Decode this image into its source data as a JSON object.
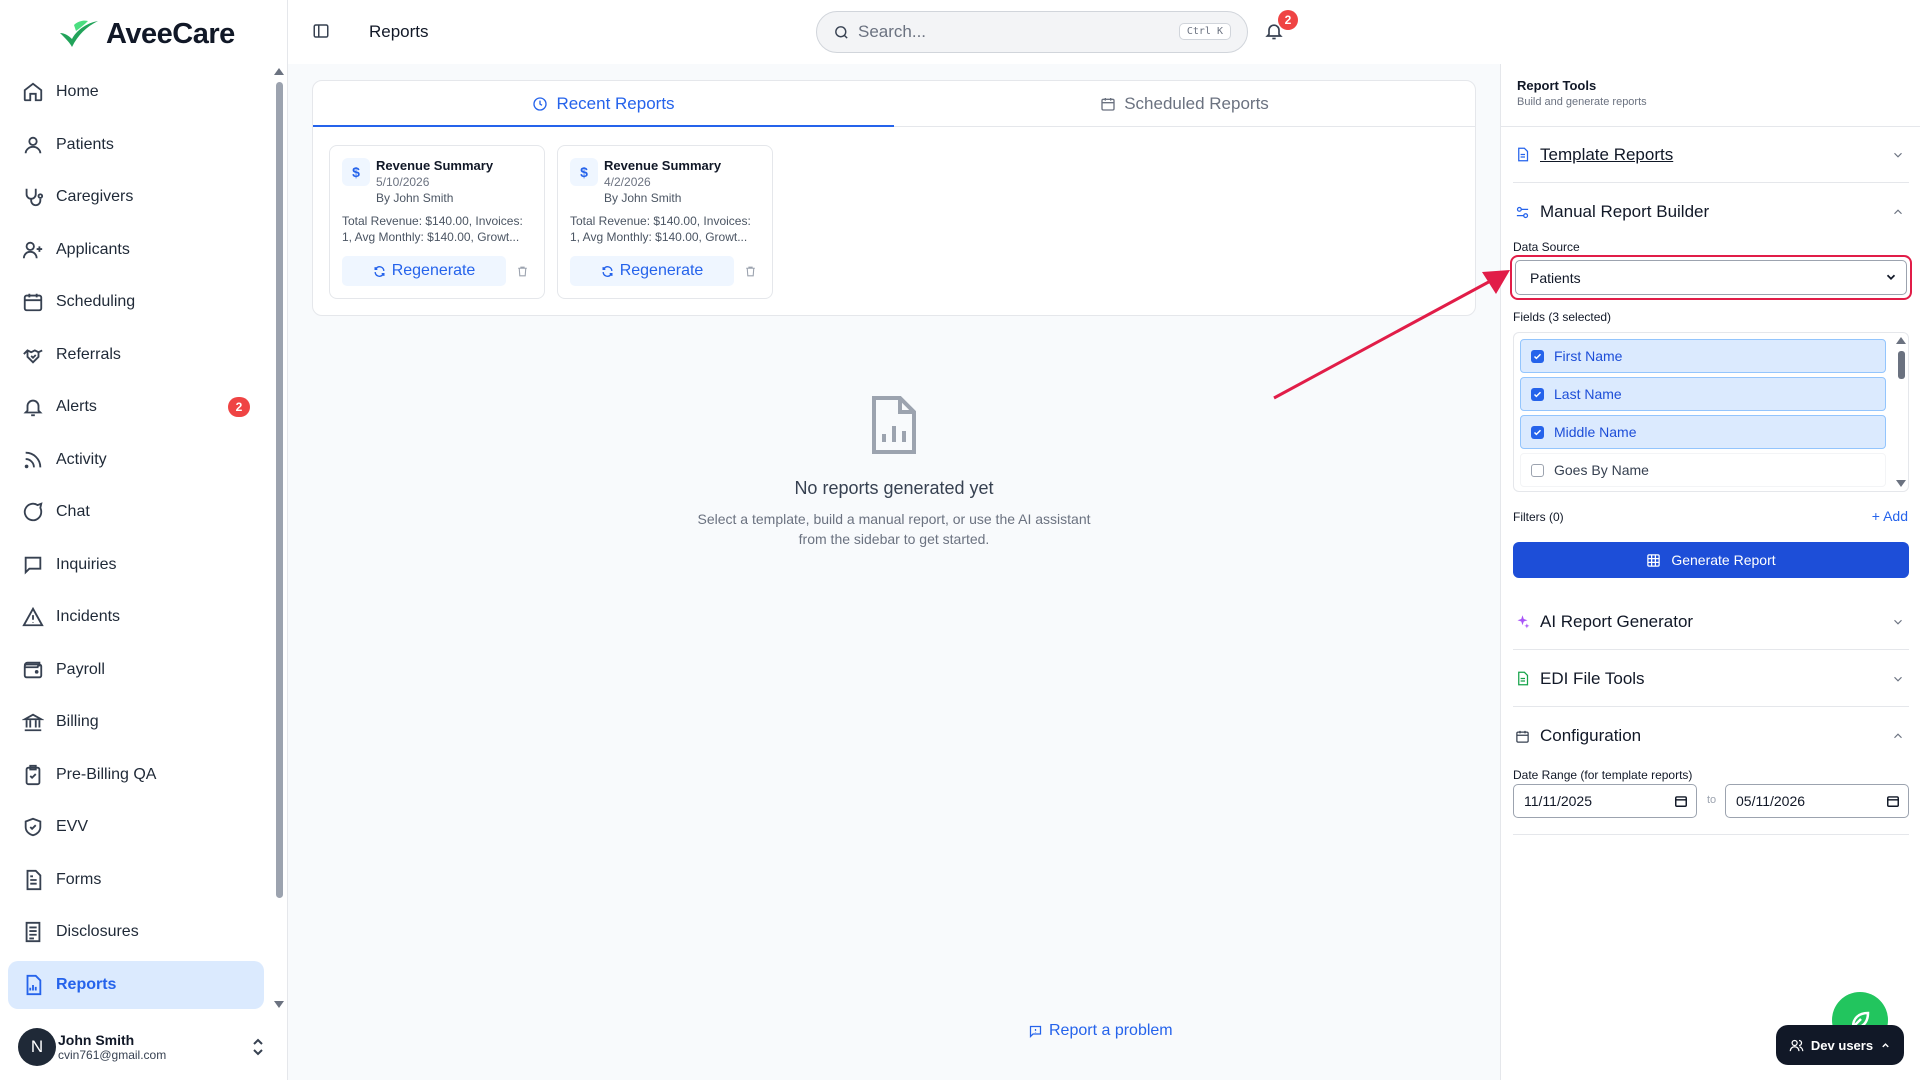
{
  "app": {
    "name": "AveeCare"
  },
  "sidebar": {
    "items": [
      {
        "label": "Home",
        "icon": "home-icon"
      },
      {
        "label": "Patients",
        "icon": "user-icon"
      },
      {
        "label": "Caregivers",
        "icon": "stethoscope-icon"
      },
      {
        "label": "Applicants",
        "icon": "user-plus-icon"
      },
      {
        "label": "Scheduling",
        "icon": "calendar-icon"
      },
      {
        "label": "Referrals",
        "icon": "handshake-icon"
      },
      {
        "label": "Alerts",
        "icon": "bell-icon",
        "badge": "2"
      },
      {
        "label": "Activity",
        "icon": "rss-icon"
      },
      {
        "label": "Chat",
        "icon": "chat-bubble-icon"
      },
      {
        "label": "Inquiries",
        "icon": "message-square-icon"
      },
      {
        "label": "Incidents",
        "icon": "alert-triangle-icon"
      },
      {
        "label": "Payroll",
        "icon": "wallet-icon"
      },
      {
        "label": "Billing",
        "icon": "bank-icon"
      },
      {
        "label": "Pre-Billing QA",
        "icon": "clipboard-check-icon"
      },
      {
        "label": "EVV",
        "icon": "shield-check-icon"
      },
      {
        "label": "Forms",
        "icon": "file-text-icon"
      },
      {
        "label": "Disclosures",
        "icon": "file-list-icon"
      },
      {
        "label": "Reports",
        "icon": "file-chart-icon",
        "active": true
      }
    ],
    "user": {
      "initial": "N",
      "name": "John Smith",
      "email": "cvin761@gmail.com"
    }
  },
  "topbar": {
    "title": "Reports",
    "search_placeholder": "Search...",
    "shortcut": "Ctrl K",
    "notifications": "2"
  },
  "main": {
    "tabs": [
      {
        "label": "Recent Reports",
        "active": true
      },
      {
        "label": "Scheduled Reports",
        "active": false
      }
    ],
    "reports": [
      {
        "title": "Revenue Summary",
        "date": "5/10/2026",
        "by": "By John Smith",
        "description": "Total Revenue: $140.00, Invoices: 1, Avg Monthly: $140.00, Growt...",
        "action": "Regenerate"
      },
      {
        "title": "Revenue Summary",
        "date": "4/2/2026",
        "by": "By John Smith",
        "description": "Total Revenue: $140.00, Invoices: 1, Avg Monthly: $140.00, Growt...",
        "action": "Regenerate"
      }
    ],
    "empty": {
      "title": "No reports generated yet",
      "line1": "Select a template, build a manual report, or use the AI assistant",
      "line2": "from the sidebar to get started."
    },
    "report_problem": "Report a problem"
  },
  "panel": {
    "title": "Report Tools",
    "subtitle": "Build and generate reports",
    "template_reports": "Template Reports",
    "manual_builder": "Manual Report Builder",
    "data_source_label": "Data Source",
    "data_source_value": "Patients",
    "fields_label": "Fields (3 selected)",
    "fields": [
      {
        "label": "First Name",
        "checked": true
      },
      {
        "label": "Last Name",
        "checked": true
      },
      {
        "label": "Middle Name",
        "checked": true
      },
      {
        "label": "Goes By Name",
        "checked": false
      }
    ],
    "filters_label": "Filters (0)",
    "add_label": "+ Add",
    "generate_label": "Generate Report",
    "ai_generator": "AI Report Generator",
    "edi_tools": "EDI File Tools",
    "configuration": "Configuration",
    "date_range_label": "Date Range (for template reports)",
    "date_from": "11/11/2025",
    "date_to_sep": "to",
    "date_to": "05/11/2026"
  },
  "floating": {
    "dev_users": "Dev users"
  },
  "colors": {
    "primary": "#2563eb",
    "danger": "#ef4444",
    "highlight": "#e11d48",
    "success": "#22c55e"
  }
}
